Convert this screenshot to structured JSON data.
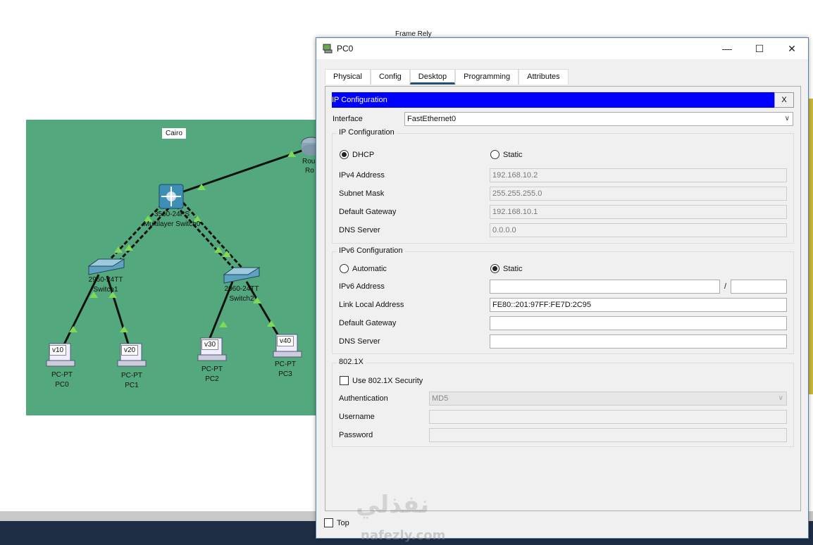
{
  "background": {
    "frame_label": "Frame Rely",
    "cluster_label": "Cairo",
    "router_label_partial": "Rou",
    "router_label_partial2": "Ro",
    "multilayer_switch": {
      "model": "3560-24PS",
      "name": "Multilayer Switch0"
    },
    "switch1": {
      "model": "2960-24TT",
      "name": "Switch1"
    },
    "switch2": {
      "model": "2960-24TT",
      "name": "Switch2"
    },
    "pcs": [
      {
        "vlan": "v10",
        "type": "PC-PT",
        "name": "PC0"
      },
      {
        "vlan": "v20",
        "type": "PC-PT",
        "name": "PC1"
      },
      {
        "vlan": "v30",
        "type": "PC-PT",
        "name": "PC2"
      },
      {
        "vlan": "v40",
        "type": "PC-PT",
        "name": "PC3"
      }
    ],
    "colors": {
      "cluster": "#53a97d",
      "link_marker": "#7ed957",
      "taskbar": "#1e2f45"
    }
  },
  "window": {
    "title": "PC0",
    "min_icon": "minimize-icon",
    "max_icon": "maximize-icon",
    "close_icon": "close-icon"
  },
  "tabs": [
    {
      "label": "Physical",
      "active": false
    },
    {
      "label": "Config",
      "active": false
    },
    {
      "label": "Desktop",
      "active": true
    },
    {
      "label": "Programming",
      "active": false
    },
    {
      "label": "Attributes",
      "active": false
    }
  ],
  "ip_config": {
    "header": "IP Configuration",
    "close_label": "X",
    "interface_label": "Interface",
    "interface_value": "FastEthernet0",
    "ipv4": {
      "group_title": "IP Configuration",
      "dhcp_label": "DHCP",
      "static_label": "Static",
      "mode": "DHCP",
      "fields": [
        {
          "label": "IPv4 Address",
          "value": "192.168.10.2"
        },
        {
          "label": "Subnet Mask",
          "value": "255.255.255.0"
        },
        {
          "label": "Default Gateway",
          "value": "192.168.10.1"
        },
        {
          "label": "DNS Server",
          "value": "0.0.0.0"
        }
      ]
    },
    "ipv6": {
      "group_title": "IPv6 Configuration",
      "automatic_label": "Automatic",
      "static_label": "Static",
      "mode": "Static",
      "address_label": "IPv6 Address",
      "address_value": "",
      "prefix_separator": "/",
      "prefix_value": "",
      "link_local_label": "Link Local Address",
      "link_local_value": "FE80::201:97FF:FE7D:2C95",
      "gateway_label": "Default Gateway",
      "gateway_value": "",
      "dns_label": "DNS Server",
      "dns_value": ""
    },
    "dot1x": {
      "group_title": "802.1X",
      "use_security_label": "Use 802.1X Security",
      "use_security_checked": false,
      "auth_label": "Authentication",
      "auth_value": "MD5",
      "username_label": "Username",
      "username_value": "",
      "password_label": "Password",
      "password_value": ""
    }
  },
  "footer": {
    "top_label": "Top",
    "top_checked": false
  },
  "watermark": {
    "arabic": "نفذلي",
    "latin": "nafezly.com"
  }
}
